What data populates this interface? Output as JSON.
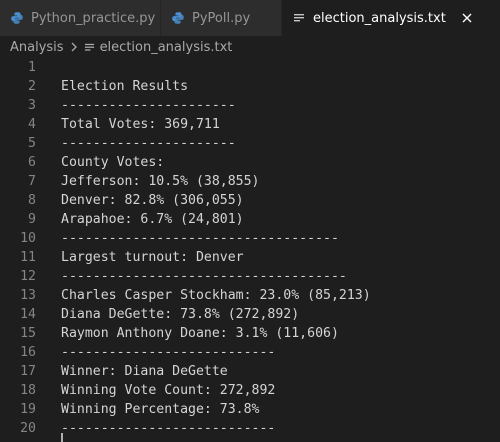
{
  "tabs": [
    {
      "label": "Python_practice.py",
      "icon": "python-icon",
      "active": false
    },
    {
      "label": "PyPoll.py",
      "icon": "python-icon",
      "active": false
    },
    {
      "label": "election_analysis.txt",
      "icon": "text-file-icon",
      "active": true,
      "close": "✕"
    }
  ],
  "breadcrumb": {
    "folder": "Analysis",
    "file": "election_analysis.txt"
  },
  "editor": {
    "lines": [
      {
        "n": "1",
        "text": ""
      },
      {
        "n": "2",
        "text": "Election Results"
      },
      {
        "n": "3",
        "text": "----------------------"
      },
      {
        "n": "4",
        "text": "Total Votes: 369,711"
      },
      {
        "n": "5",
        "text": "----------------------"
      },
      {
        "n": "6",
        "text": "County Votes:"
      },
      {
        "n": "7",
        "text": "Jefferson: 10.5% (38,855)"
      },
      {
        "n": "8",
        "text": "Denver: 82.8% (306,055)"
      },
      {
        "n": "9",
        "text": "Arapahoe: 6.7% (24,801)"
      },
      {
        "n": "10",
        "text": "-----------------------------------"
      },
      {
        "n": "11",
        "text": "Largest turnout: Denver"
      },
      {
        "n": "12",
        "text": "------------------------------------"
      },
      {
        "n": "13",
        "text": "Charles Casper Stockham: 23.0% (85,213)"
      },
      {
        "n": "14",
        "text": "Diana DeGette: 73.8% (272,892)"
      },
      {
        "n": "15",
        "text": "Raymon Anthony Doane: 3.1% (11,606)"
      },
      {
        "n": "16",
        "text": "---------------------------"
      },
      {
        "n": "17",
        "text": "Winner: Diana DeGette"
      },
      {
        "n": "18",
        "text": "Winning Vote Count: 272,892"
      },
      {
        "n": "19",
        "text": "Winning Percentage: 73.8%"
      },
      {
        "n": "20",
        "text": "---------------------------"
      }
    ]
  },
  "colors": {
    "editor_bg": "#1e1e1e",
    "tabbar_bg": "#252526",
    "inactive_tab_bg": "#2d2d2d",
    "text": "#d4d4d4",
    "line_number": "#858585",
    "python_icon": "#4a8fd0"
  }
}
